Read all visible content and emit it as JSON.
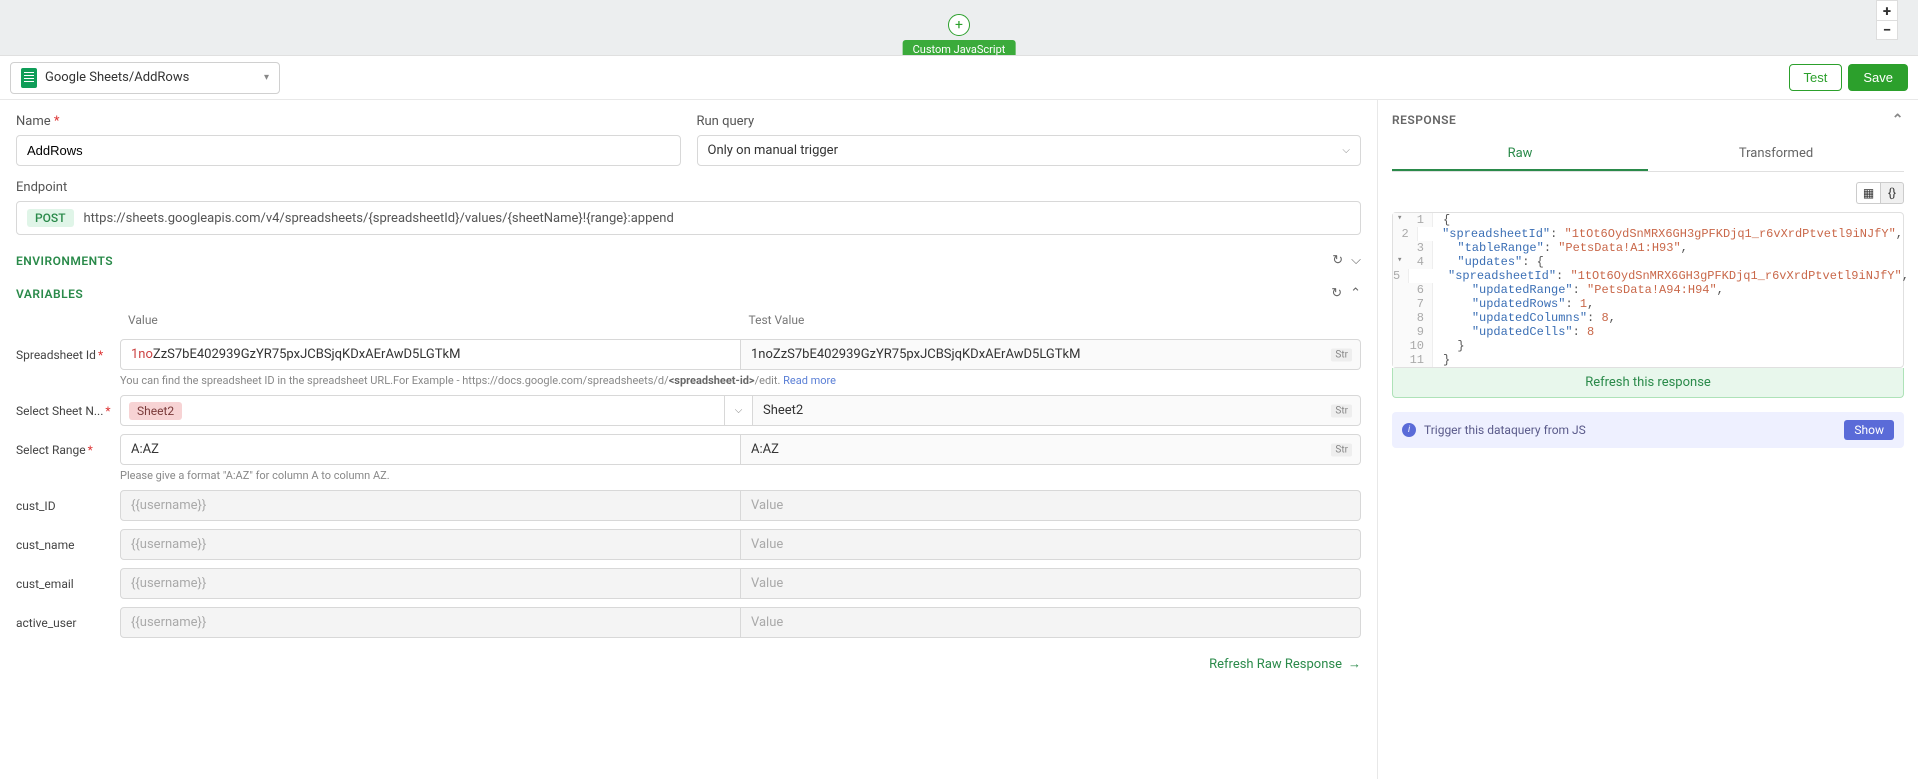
{
  "canvas": {
    "badge": "Custom JavaScript"
  },
  "header": {
    "selectedQuery": "Google Sheets/AddRows",
    "testBtn": "Test",
    "saveBtn": "Save"
  },
  "form": {
    "nameLabel": "Name",
    "nameValue": "AddRows",
    "runQueryLabel": "Run query",
    "runQueryValue": "Only on manual trigger",
    "endpointLabel": "Endpoint",
    "endpointMethod": "POST",
    "endpointUrl": "https://sheets.googleapis.com/v4/spreadsheets/{spreadsheetId}/values/{sheetName}!{range}:append",
    "envTitle": "ENVIRONMENTS",
    "varTitle": "VARIABLES",
    "colValue": "Value",
    "colTest": "Test Value",
    "vars": {
      "spreadsheetId": {
        "label": "Spreadsheet Id",
        "value": "1noZzS7bE402939GzYR75pxJCBSjqKDxAErAwD5LGTkM",
        "test": "1noZzS7bE402939GzYR75pxJCBSjqKDxAErAwD5LGTkM"
      },
      "sheetName": {
        "label": "Select Sheet N...",
        "value": "Sheet2",
        "test": "Sheet2"
      },
      "range": {
        "label": "Select Range",
        "value": "A:AZ",
        "test": "A:AZ"
      },
      "custId": {
        "label": "cust_ID"
      },
      "custName": {
        "label": "cust_name"
      },
      "custEmail": {
        "label": "cust_email"
      },
      "activeUser": {
        "label": "active_user"
      }
    },
    "helpSpreadsheetPre": "You can find the spreadsheet ID in the spreadsheet URL.For Example - https://docs.google.com/spreadsheets/d/",
    "helpSpreadsheetBold": "<spreadsheet-id>",
    "helpSpreadsheetPost": "/edit. ",
    "helpReadMore": "Read more",
    "helpRange": "Please give a format \"A:AZ\" for column A to column AZ.",
    "placeholderUser": "{{username}}",
    "placeholderValue": "Value",
    "typeTag": "Str",
    "refreshRaw": "Refresh Raw Response"
  },
  "response": {
    "title": "RESPONSE",
    "tabRaw": "Raw",
    "tabTransformed": "Transformed",
    "refreshBtn": "Refresh this response",
    "json": {
      "spreadsheetId": "1tOt6OydSnMRX6GH3gPFKDjq1_r6vXrdPtvetl9iNJfY",
      "tableRange": "PetsData!A1:H93",
      "updates": {
        "spreadsheetId": "1tOt6OydSnMRX6GH3gPFKDjq1_r6vXrdPtvetl9iNJfY",
        "updatedRange": "PetsData!A94:H94",
        "updatedRows": 1,
        "updatedColumns": 8,
        "updatedCells": 8
      }
    }
  },
  "trigger": {
    "text": "Trigger this dataquery from JS",
    "btn": "Show"
  }
}
